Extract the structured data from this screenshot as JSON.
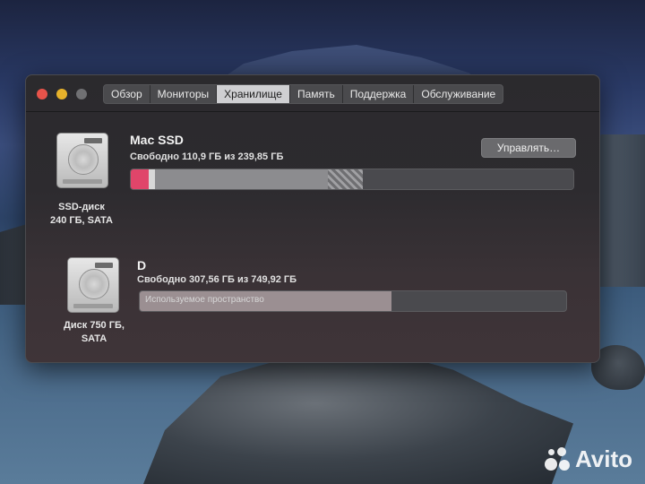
{
  "window": {
    "tabs": [
      {
        "label": "Обзор",
        "active": false
      },
      {
        "label": "Мониторы",
        "active": false
      },
      {
        "label": "Хранилище",
        "active": true
      },
      {
        "label": "Память",
        "active": false
      },
      {
        "label": "Поддержка",
        "active": false
      },
      {
        "label": "Обслуживание",
        "active": false
      }
    ]
  },
  "disks": [
    {
      "caption": "SSD-диск\n240 ГБ, SATA",
      "name": "Mac SSD",
      "free": "Свободно 110,9 ГБ из 239,85 ГБ",
      "manage_label": "Управлять…",
      "usage_segments": [
        {
          "kind": "apps",
          "fraction": 0.04,
          "color": "#e0456a"
        },
        {
          "kind": "other",
          "fraction": 0.015,
          "color": "#d8d8d8"
        },
        {
          "kind": "system",
          "fraction": 0.39,
          "color": "#8c8c8f"
        },
        {
          "kind": "purgeable",
          "fraction": 0.08,
          "color": "#7a7a7d"
        },
        {
          "kind": "free",
          "fraction": 0.475,
          "color": "#4a4a4e"
        }
      ]
    },
    {
      "caption": "Диск 750 ГБ,\nSATA",
      "name": "D",
      "free": "Свободно 307,56 ГБ из 749,92 ГБ",
      "bar_label": "Используемое пространство",
      "used_fraction": 0.59,
      "used_color": "#9b8f92"
    }
  ],
  "watermark": "Avito"
}
